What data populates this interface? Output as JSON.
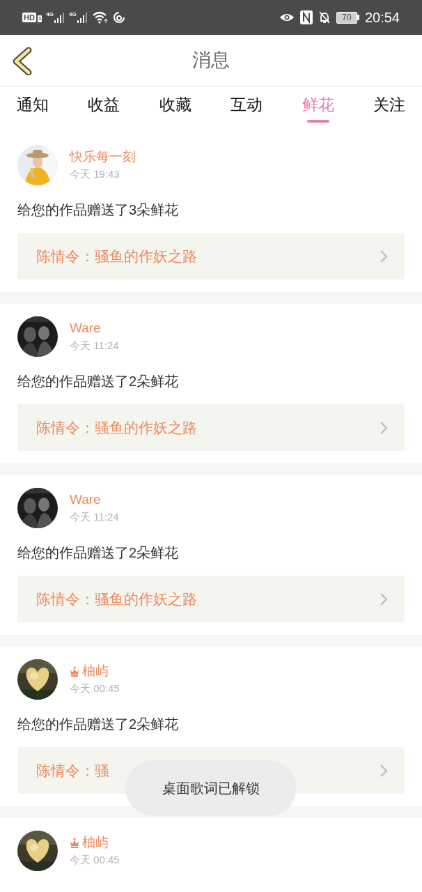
{
  "status_bar": {
    "hd": "HD",
    "sim": "1",
    "network_1": "4G",
    "network_2": "4G",
    "battery": "70",
    "time": "20:54"
  },
  "header": {
    "title": "消息"
  },
  "tabs": [
    {
      "label": "通知",
      "selected": false
    },
    {
      "label": "收益",
      "selected": false
    },
    {
      "label": "收藏",
      "selected": false
    },
    {
      "label": "互动",
      "selected": false
    },
    {
      "label": "鲜花",
      "selected": true
    },
    {
      "label": "关注",
      "selected": false
    }
  ],
  "messages": [
    {
      "name": "快乐每一刻",
      "vip": false,
      "time": "今天 19:43",
      "text": "给您的作品赠送了3朵鲜花",
      "work": "陈情令：骚鱼的作妖之路"
    },
    {
      "name": "Ware",
      "vip": false,
      "time": "今天 11:24",
      "text": "给您的作品赠送了2朵鲜花",
      "work": "陈情令：骚鱼的作妖之路"
    },
    {
      "name": "Ware",
      "vip": false,
      "time": "今天 11:24",
      "text": "给您的作品赠送了2朵鲜花",
      "work": "陈情令：骚鱼的作妖之路"
    },
    {
      "name": "柚屿",
      "vip": true,
      "time": "今天 00:45",
      "text": "给您的作品赠送了2朵鲜花",
      "work": "陈情令：骚"
    },
    {
      "name": "柚屿",
      "vip": true,
      "time": "今天 00:45"
    }
  ],
  "toast": "桌面歌词已解锁"
}
